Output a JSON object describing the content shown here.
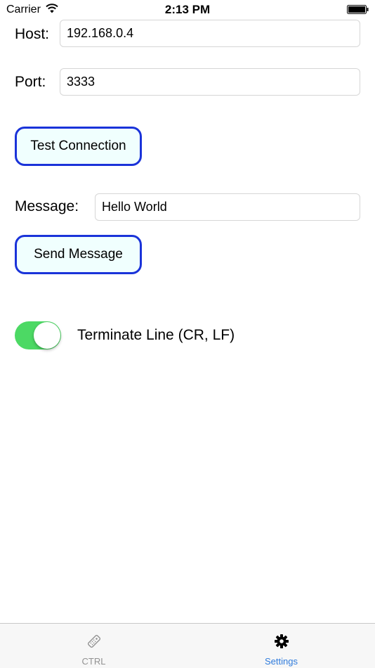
{
  "status_bar": {
    "carrier": "Carrier",
    "time": "2:13 PM"
  },
  "form": {
    "host": {
      "label": "Host:",
      "value": "192.168.0.4"
    },
    "port": {
      "label": "Port:",
      "value": "3333"
    },
    "test_connection_label": "Test Connection",
    "message": {
      "label": "Message:",
      "value": "Hello World"
    },
    "send_message_label": "Send Message",
    "terminate_line": {
      "label": "Terminate Line (CR, LF)",
      "enabled": true
    }
  },
  "tab_bar": {
    "tabs": [
      {
        "label": "CTRL",
        "icon": "remote-icon",
        "active": false
      },
      {
        "label": "Settings",
        "icon": "gear-icon",
        "active": true
      }
    ]
  },
  "colors": {
    "button_border": "#1a33d9",
    "button_fill": "#f0fffe",
    "toggle_on": "#4cd964",
    "tab_active": "#2f7bdc",
    "tab_inactive": "#929292"
  }
}
